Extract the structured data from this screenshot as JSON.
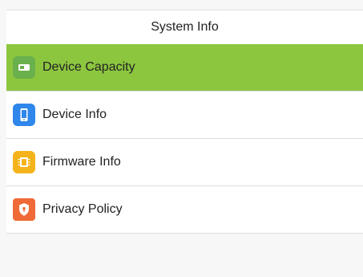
{
  "header": {
    "title": "System Info"
  },
  "menu": {
    "items": [
      {
        "label": "Device Capacity",
        "icon": "storage-icon",
        "icon_color": "#6ab04c",
        "selected": true
      },
      {
        "label": "Device Info",
        "icon": "phone-icon",
        "icon_color": "#2f86eb",
        "selected": false
      },
      {
        "label": "Firmware Info",
        "icon": "chip-icon",
        "icon_color": "#f5b31b",
        "selected": false
      },
      {
        "label": "Privacy Policy",
        "icon": "shield-icon",
        "icon_color": "#ef6a36",
        "selected": false
      }
    ]
  },
  "colors": {
    "selected_bg": "#8cc63f",
    "divider": "#dcdcdc"
  }
}
